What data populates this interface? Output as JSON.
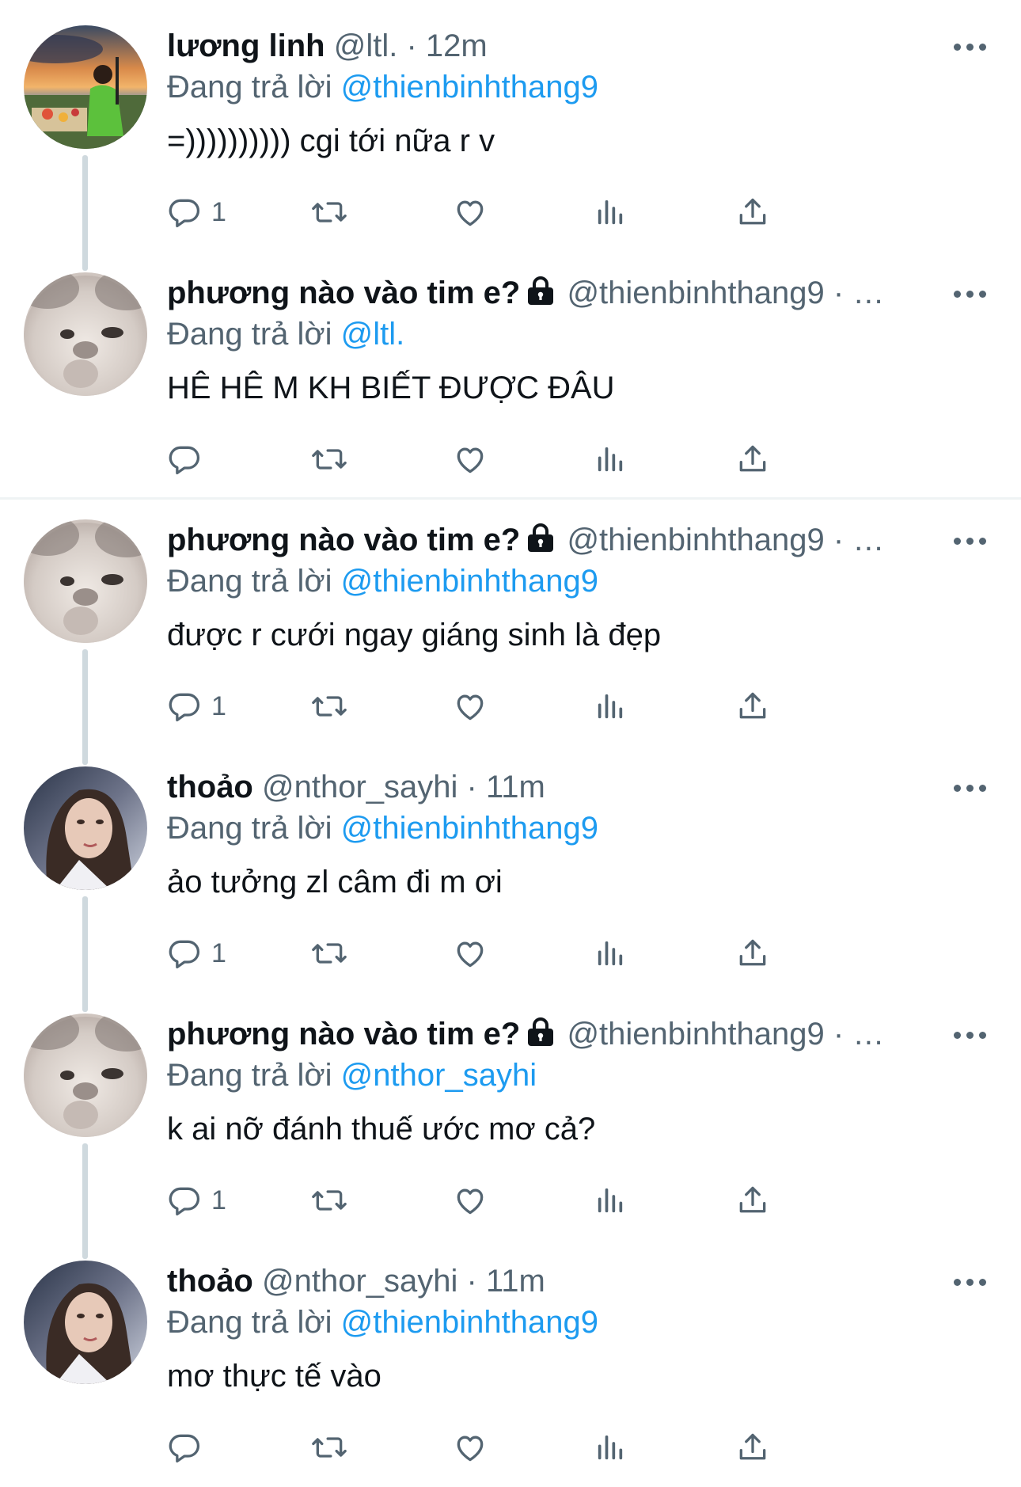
{
  "tweets": [
    {
      "name": "lương linh",
      "locked": false,
      "handle": "@ltl.",
      "dot": "·",
      "time": "12m",
      "reply_prefix": "Đang trả lời",
      "reply_target": "@thienbinhthang9",
      "text": "=)))))))))) cgi tới nữa r v",
      "reply_count": "1",
      "avatar": "avatar-sunset-photo"
    },
    {
      "name": "phương nào vào tim e?",
      "locked": true,
      "handle": "@thienbinhthang9",
      "dot": "·",
      "time": "…",
      "reply_prefix": "Đang trả lời",
      "reply_target": "@ltl.",
      "text": "HÊ HÊ M KH BIẾT ĐƯỢC ĐÂU",
      "reply_count": "",
      "avatar": "avatar-cat-photo"
    },
    {
      "name": "phương nào vào tim e?",
      "locked": true,
      "handle": "@thienbinhthang9",
      "dot": "·",
      "time": "…",
      "reply_prefix": "Đang trả lời",
      "reply_target": "@thienbinhthang9",
      "text": "được r cưới ngay giáng sinh là đẹp",
      "reply_count": "1",
      "avatar": "avatar-cat-photo"
    },
    {
      "name": "thoảo",
      "locked": false,
      "handle": "@nthor_sayhi",
      "dot": "·",
      "time": "11m",
      "reply_prefix": "Đang trả lời",
      "reply_target": "@thienbinhthang9",
      "text": "ảo tưởng zl câm đi m ơi",
      "reply_count": "1",
      "avatar": "avatar-woman-photo"
    },
    {
      "name": "phương nào vào tim e?",
      "locked": true,
      "handle": "@thienbinhthang9",
      "dot": "·",
      "time": "…",
      "reply_prefix": "Đang trả lời",
      "reply_target": "@nthor_sayhi",
      "text": "k ai nỡ đánh thuế ước mơ cả?",
      "reply_count": "1",
      "avatar": "avatar-cat-photo"
    },
    {
      "name": "thoảo",
      "locked": false,
      "handle": "@nthor_sayhi",
      "dot": "·",
      "time": "11m",
      "reply_prefix": "Đang trả lời",
      "reply_target": "@thienbinhthang9",
      "text": "mơ thực tế vào",
      "reply_count": "",
      "avatar": "avatar-woman-photo"
    }
  ],
  "icons": {
    "reply": "reply-icon",
    "retweet": "retweet-icon",
    "like": "like-icon",
    "views": "views-icon",
    "share": "share-icon",
    "more": "more-icon",
    "lock": "lock-icon"
  },
  "colors": {
    "link": "#1d9bf0",
    "secondary": "#536471",
    "text": "#0f1419",
    "thread_line": "#cfd9de"
  }
}
